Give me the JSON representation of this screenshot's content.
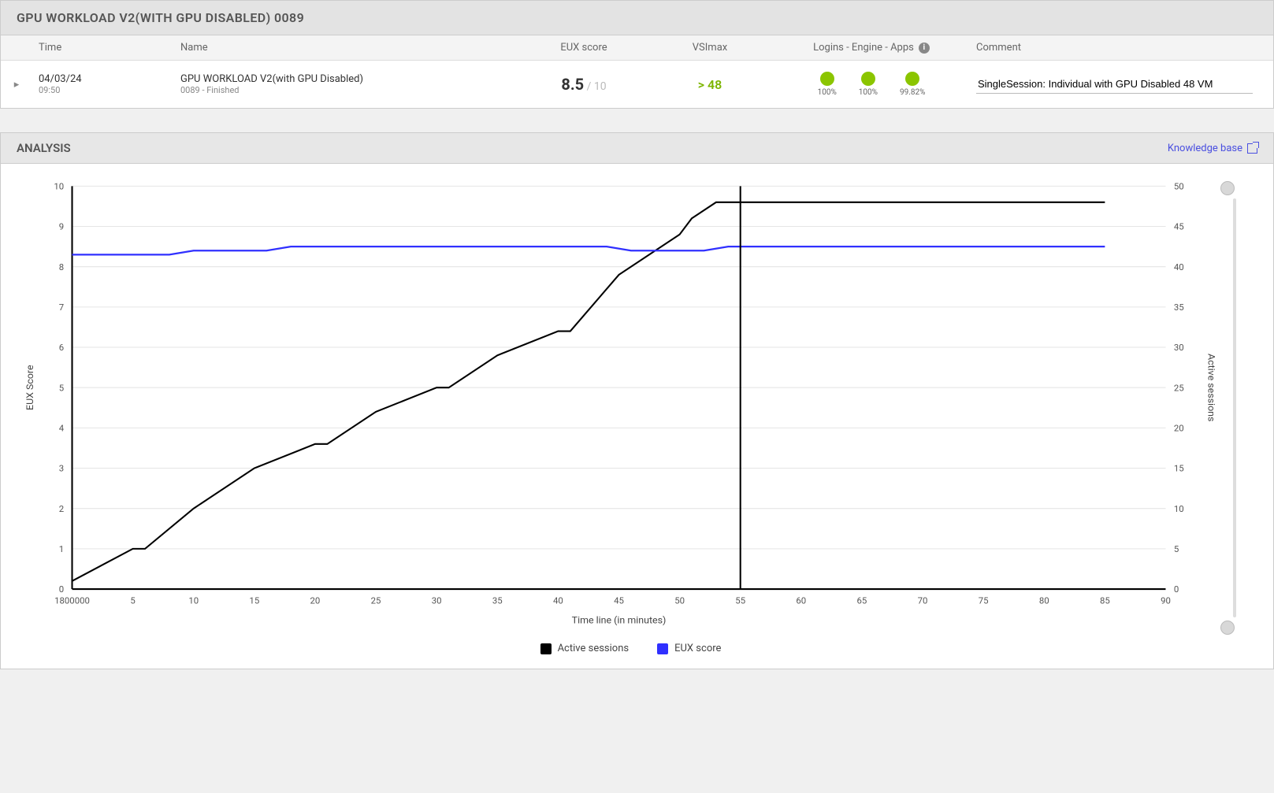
{
  "header": {
    "title": "GPU WORKLOAD V2(WITH GPU DISABLED) 0089"
  },
  "table": {
    "columns": {
      "time": "Time",
      "name": "Name",
      "eux": "EUX score",
      "vsimax": "VSImax",
      "logins": "Logins - Engine - Apps",
      "comment": "Comment"
    },
    "row": {
      "date": "04/03/24",
      "time": "09:50",
      "name": "GPU WORKLOAD V2(with GPU Disabled)",
      "name_sub": "0089 - Finished",
      "eux_value": "8.5",
      "eux_max": " / 10",
      "vsimax": "> 48",
      "status": [
        {
          "pct": "100%"
        },
        {
          "pct": "100%"
        },
        {
          "pct": "99.82%"
        }
      ],
      "comment": "SingleSession: Individual with GPU Disabled 48 VM"
    }
  },
  "analysis": {
    "title": "ANALYSIS",
    "kb_link": "Knowledge base"
  },
  "chart": {
    "x_label": "Time line (in minutes)",
    "y_left_label": "EUX Score",
    "y_right_label": "Active sessions",
    "legend": {
      "series_a": "Active sessions",
      "series_b": "EUX score"
    },
    "x_first_tick": "1800000",
    "colors": {
      "active": "#000000",
      "eux": "#3030ff",
      "status_dot": "#8bc500"
    }
  },
  "chart_data": {
    "type": "line",
    "xlabel": "Time line (in minutes)",
    "x_ticks": [
      "1800000",
      5,
      10,
      15,
      20,
      25,
      30,
      35,
      40,
      45,
      50,
      55,
      60,
      65,
      70,
      75,
      80,
      85,
      90
    ],
    "cursor_x": 55,
    "left_axis": {
      "label": "EUX Score",
      "range": [
        0,
        10
      ],
      "ticks": [
        0,
        1,
        2,
        3,
        4,
        5,
        6,
        7,
        8,
        9,
        10
      ]
    },
    "right_axis": {
      "label": "Active sessions",
      "range": [
        0,
        50
      ],
      "ticks": [
        0,
        5,
        10,
        15,
        20,
        25,
        30,
        35,
        40,
        45,
        50
      ]
    },
    "series": [
      {
        "name": "Active sessions",
        "axis": "right",
        "color": "#000000",
        "x": [
          0,
          5,
          6,
          10,
          11,
          15,
          20,
          21,
          25,
          30,
          31,
          35,
          40,
          41,
          45,
          50,
          51,
          53,
          55,
          60,
          65,
          70,
          75,
          80,
          85
        ],
        "values": [
          1,
          5,
          5,
          10,
          11,
          15,
          18,
          18,
          22,
          25,
          25,
          29,
          32,
          32,
          39,
          44,
          46,
          48,
          48,
          48,
          48,
          48,
          48,
          48,
          48
        ]
      },
      {
        "name": "EUX score",
        "axis": "left",
        "color": "#3030ff",
        "x": [
          0,
          8,
          10,
          16,
          18,
          44,
          46,
          48,
          52,
          54,
          85
        ],
        "values": [
          8.3,
          8.3,
          8.4,
          8.4,
          8.5,
          8.5,
          8.4,
          8.4,
          8.4,
          8.5,
          8.5
        ]
      }
    ]
  }
}
